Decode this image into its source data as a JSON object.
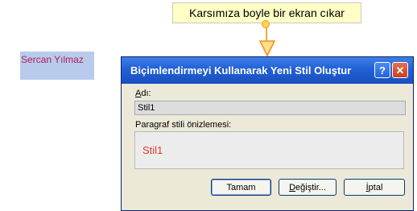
{
  "callout": {
    "text": "Karsımıza boyle bir ekran cıkar"
  },
  "author": {
    "name": "Sercan Yılmaz"
  },
  "dialog": {
    "title": "Biçimlendirmeyi Kullanarak Yeni Stil Oluştur",
    "help_label": "?",
    "close_label": "✕",
    "name_label_underlined": "A",
    "name_label_rest": "dı:",
    "name_value": "Stil1",
    "preview_label": "Paragraf stili önizlemesi:",
    "preview_text": "Stil1",
    "buttons": {
      "ok": "Tamam",
      "modify_underlined": "D",
      "modify_rest": "eğiştir...",
      "cancel_underlined": "İ",
      "cancel_rest": "ptal"
    }
  },
  "colors": {
    "callout_bg": "#ffffc6",
    "name_block_bg": "#b8cbec",
    "titlebar": "#2160d6",
    "preview_text": "#e03a2a"
  }
}
